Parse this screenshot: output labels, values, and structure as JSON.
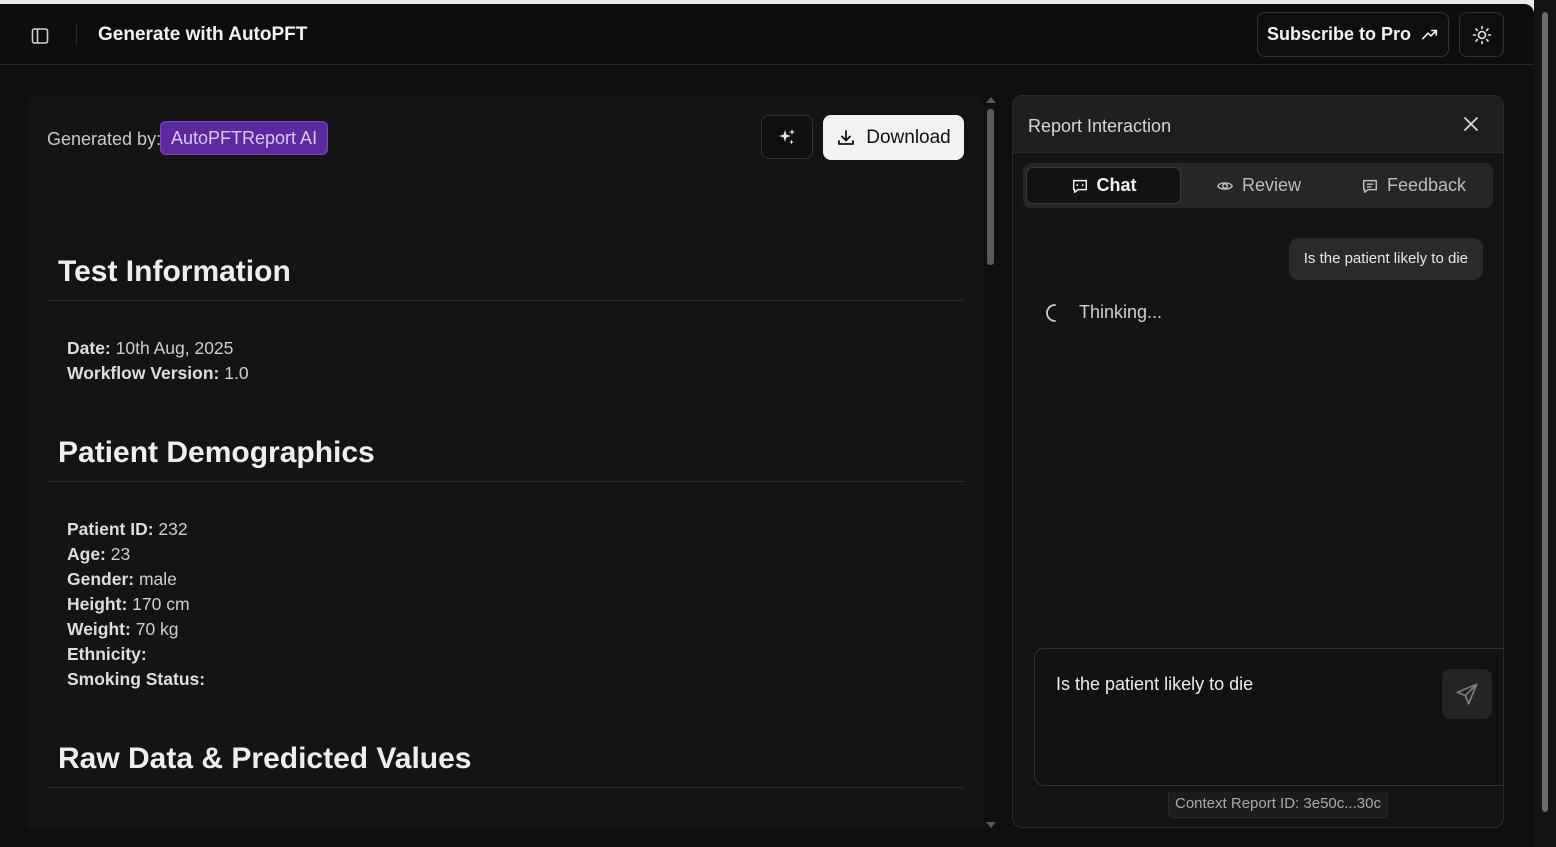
{
  "header": {
    "title": "Generate with AutoPFT",
    "subscribe_label": "Subscribe to Pro"
  },
  "report": {
    "generated_by_label": "Generated by:",
    "generator_badge": "AutoPFTReport AI",
    "download_label": "Download",
    "sections": [
      {
        "title": "Test Information",
        "fields": [
          {
            "label": "Date:",
            "value": "10th Aug, 2025"
          },
          {
            "label": "Workflow Version:",
            "value": "1.0"
          }
        ]
      },
      {
        "title": "Patient Demographics",
        "fields": [
          {
            "label": "Patient ID:",
            "value": "232"
          },
          {
            "label": "Age:",
            "value": "23"
          },
          {
            "label": "Gender:",
            "value": "male"
          },
          {
            "label": "Height:",
            "value": "170 cm"
          },
          {
            "label": "Weight:",
            "value": "70 kg"
          },
          {
            "label": "Ethnicity:",
            "value": ""
          },
          {
            "label": "Smoking Status:",
            "value": ""
          }
        ]
      },
      {
        "title": "Raw Data & Predicted Values",
        "fields": []
      }
    ]
  },
  "interaction": {
    "title": "Report Interaction",
    "tabs": [
      {
        "label": "Chat"
      },
      {
        "label": "Review"
      },
      {
        "label": "Feedback"
      }
    ],
    "messages": [
      {
        "role": "user",
        "text": "Is the patient likely to die"
      }
    ],
    "thinking_label": "Thinking...",
    "composer_value": "Is the patient likely to die",
    "context_report_id": "Context Report ID: 3e50c...30c"
  },
  "colors": {
    "background": "#0f0f0f",
    "panel": "#141414",
    "badge_purple": "#5b2a9c",
    "download_bg": "#f2f2f2"
  }
}
